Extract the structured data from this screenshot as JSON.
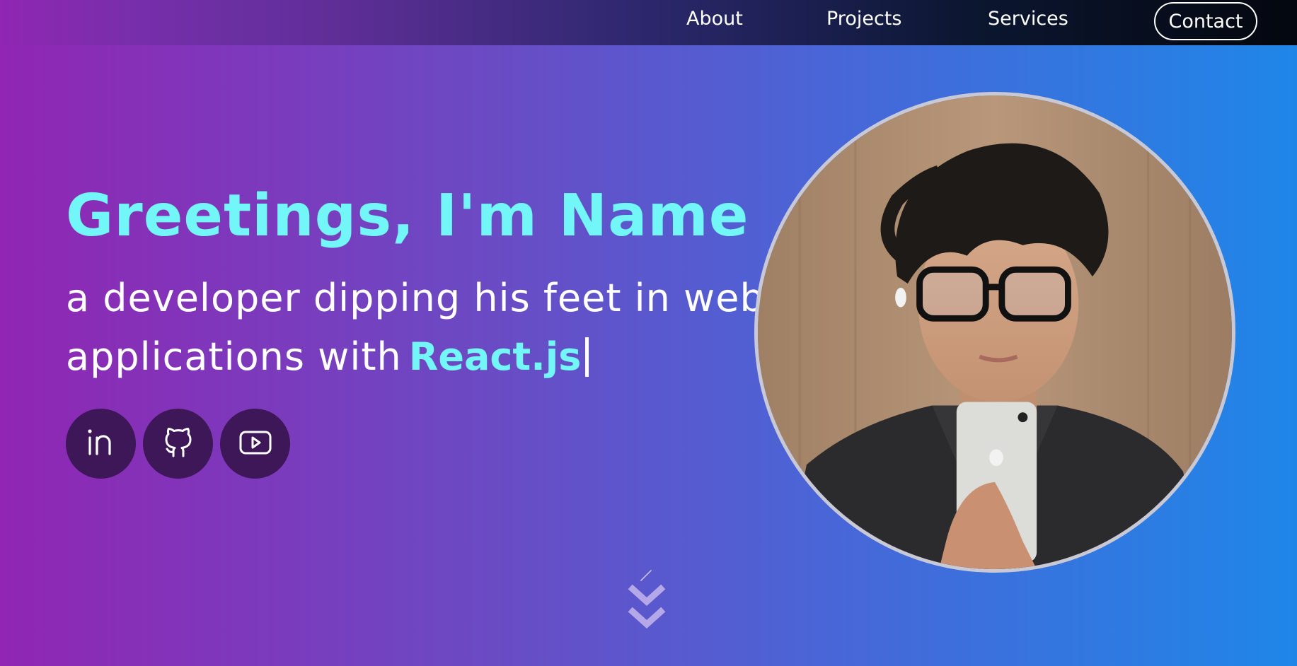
{
  "nav": {
    "about": "About",
    "projects": "Projects",
    "services": "Services",
    "contact": "Contact"
  },
  "hero": {
    "title": "Greetings, I'm Name",
    "subtitle_line1": "a developer dipping his feet in web",
    "subtitle_line2": "applications with",
    "tech": "React.js"
  },
  "socials": [
    {
      "icon": "linkedin-icon"
    },
    {
      "icon": "github-icon"
    },
    {
      "icon": "youtube-icon"
    }
  ],
  "portrait": {
    "icon": "profile-photo"
  },
  "scroll": {
    "icon": "chevron-double-down-icon"
  },
  "colors": {
    "accent": "#72f6f7",
    "gradient_start": "#9026b3",
    "gradient_end": "#1f86e8",
    "social_bg": "#3d1757",
    "nav_dark": "#04070f"
  }
}
